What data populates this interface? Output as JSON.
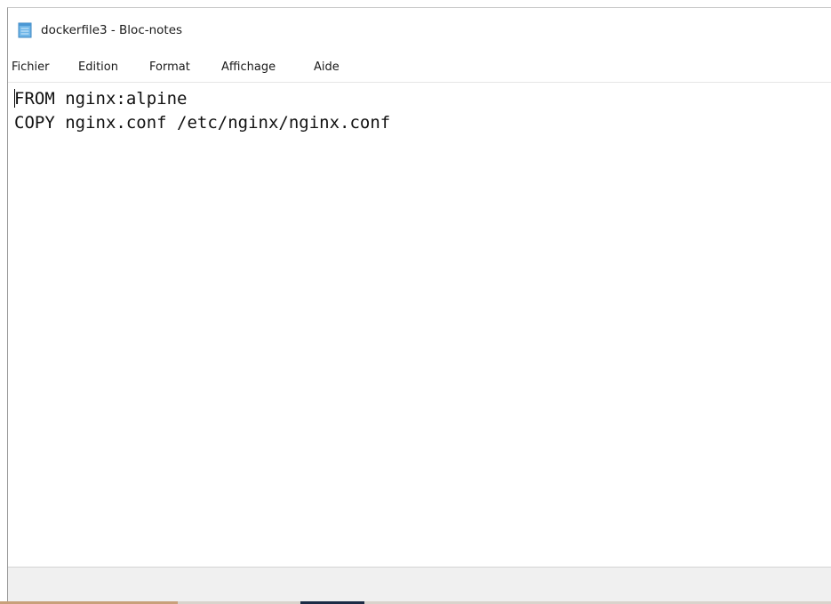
{
  "window": {
    "title": "dockerfile3 - Bloc-notes",
    "icon": "notepad-icon"
  },
  "menubar": {
    "items": [
      "Fichier",
      "Edition",
      "Format",
      "Affichage",
      "Aide"
    ]
  },
  "editor": {
    "lines": [
      "FROM nginx:alpine",
      "COPY nginx.conf /etc/nginx/nginx.conf"
    ]
  },
  "colors": {
    "background": "#ffffff",
    "statusbar": "#f0f0f0",
    "text": "#111111"
  }
}
